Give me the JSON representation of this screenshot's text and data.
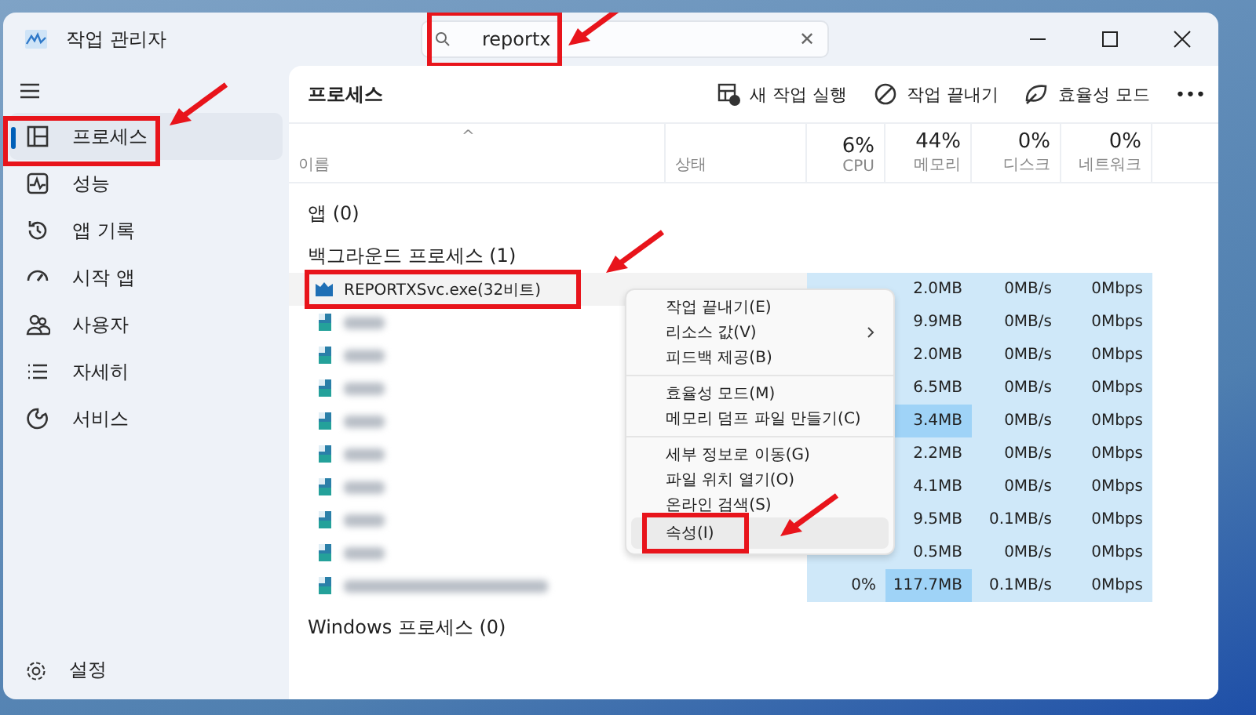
{
  "window": {
    "title": "작업 관리자"
  },
  "search": {
    "value": "reportx",
    "clear": "✕",
    "marked": true
  },
  "sidebar": {
    "items": [
      {
        "label": "프로세스",
        "selected": true,
        "marked": true
      },
      {
        "label": "성능",
        "selected": false,
        "marked": false
      },
      {
        "label": "앱 기록",
        "selected": false,
        "marked": false
      },
      {
        "label": "시작 앱",
        "selected": false,
        "marked": false
      },
      {
        "label": "사용자",
        "selected": false,
        "marked": false
      },
      {
        "label": "자세히",
        "selected": false,
        "marked": false
      },
      {
        "label": "서비스",
        "selected": false,
        "marked": false
      }
    ],
    "settings": "설정"
  },
  "page_title": "프로세스",
  "toolbar": [
    {
      "label": "새 작업 실행"
    },
    {
      "label": "작업 끝내기"
    },
    {
      "label": "효율성 모드"
    },
    {
      "label": "•••"
    }
  ],
  "columns": [
    {
      "label": "이름",
      "sort": "^"
    },
    {
      "label": "상태"
    },
    {
      "label": "CPU",
      "usage": "6%"
    },
    {
      "label": "메모리",
      "usage": "44%"
    },
    {
      "label": "디스크",
      "usage": "0%"
    },
    {
      "label": "네트워크",
      "usage": "0%"
    }
  ],
  "groups": [
    {
      "label": "앱 (0)"
    },
    {
      "label": "백그라운드 프로세스 (1)",
      "rows": [
        {
          "kind": "named",
          "name": "REPORTXSvc.exe(32비트)",
          "marked": true,
          "mem": "2.0MB",
          "mem_high": false,
          "disk": "0MB/s",
          "net": "0Mbps"
        },
        {
          "kind": "blurred",
          "marked": false,
          "mem": "9.9MB",
          "mem_high": false,
          "disk": "0MB/s",
          "net": "0Mbps"
        },
        {
          "kind": "blurred",
          "marked": false,
          "mem": "2.0MB",
          "mem_high": false,
          "disk": "0MB/s",
          "net": "0Mbps"
        },
        {
          "kind": "blurred",
          "marked": false,
          "mem": "6.5MB",
          "mem_high": false,
          "disk": "0MB/s",
          "net": "0Mbps"
        },
        {
          "kind": "blurred",
          "marked": false,
          "mem": "3.4MB",
          "mem_high": true,
          "disk": "0MB/s",
          "net": "0Mbps"
        },
        {
          "kind": "blurred",
          "marked": false,
          "mem": "2.2MB",
          "mem_high": false,
          "disk": "0MB/s",
          "net": "0Mbps"
        },
        {
          "kind": "blurred",
          "marked": false,
          "mem": "4.1MB",
          "mem_high": false,
          "disk": "0MB/s",
          "net": "0Mbps"
        },
        {
          "kind": "blurred",
          "marked": false,
          "mem": "9.5MB",
          "mem_high": false,
          "disk": "0.1MB/s",
          "net": "0Mbps"
        },
        {
          "kind": "blurred",
          "marked": false,
          "mem": "0.5MB",
          "mem_high": false,
          "disk": "0MB/s",
          "net": "0Mbps"
        },
        {
          "kind": "blurred_long",
          "marked": false,
          "cpu": "0%",
          "mem": "117.7MB",
          "mem_high": true,
          "disk": "0.1MB/s",
          "net": "0Mbps"
        }
      ]
    },
    {
      "label": "Windows 프로세스 (0)"
    }
  ],
  "context_menu": {
    "groups": [
      [
        {
          "label": "작업 끝내기(E)",
          "submenu": false,
          "selected": false,
          "marked": false
        },
        {
          "label": "리소스 값(V)",
          "submenu": true,
          "selected": false,
          "marked": false
        },
        {
          "label": "피드백 제공(B)",
          "submenu": false,
          "selected": false,
          "marked": false
        }
      ],
      [
        {
          "label": "효율성 모드(M)",
          "submenu": false,
          "selected": false,
          "marked": false
        },
        {
          "label": "메모리 덤프 파일 만들기(C)",
          "submenu": false,
          "selected": false,
          "marked": false
        }
      ],
      [
        {
          "label": "세부 정보로 이동(G)",
          "submenu": false,
          "selected": false,
          "marked": false
        },
        {
          "label": "파일 위치 열기(O)",
          "submenu": false,
          "selected": false,
          "marked": false
        },
        {
          "label": "온라인 검색(S)",
          "submenu": false,
          "selected": false,
          "marked": false
        },
        {
          "label": "속성(I)",
          "submenu": false,
          "selected": true,
          "marked": true
        }
      ]
    ]
  }
}
